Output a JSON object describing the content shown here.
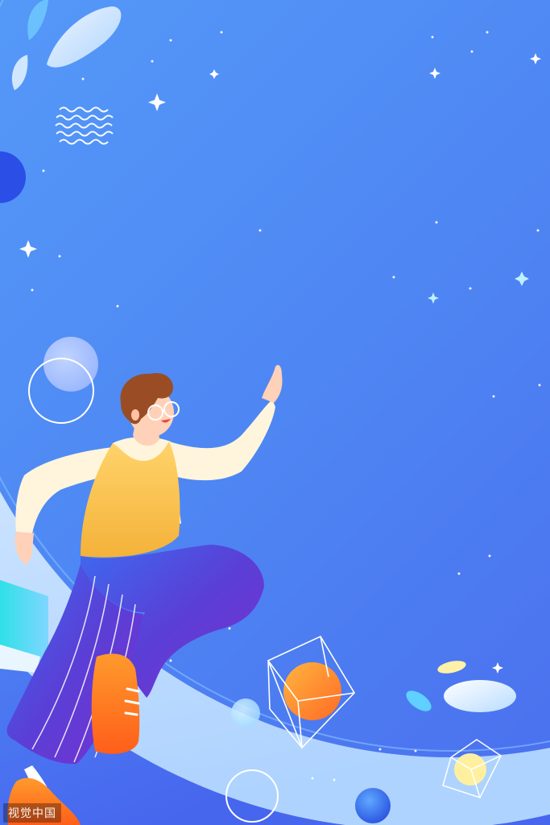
{
  "watermark": {
    "text": "视觉中国"
  },
  "colors": {
    "sky_top": "#5ba6fb",
    "sky_bottom": "#4a6cf0",
    "planet_edge": "#d9ecff",
    "vest": "#f8c34d",
    "shirt": "#fff4d8",
    "pants": "#5a3fd6",
    "shoes": "#ff7a1f",
    "hair": "#9a4d25",
    "orange_orb": "#ff8a2a",
    "yellow_orb": "#fff0a0"
  },
  "icons": {
    "character": "running-person-illustration",
    "cube_large": "wireframe-cube-icon",
    "cube_small": "wireframe-cube-icon",
    "sparkle": "four-point-star-icon",
    "wave_circle": "wavy-lines-circle-icon"
  }
}
